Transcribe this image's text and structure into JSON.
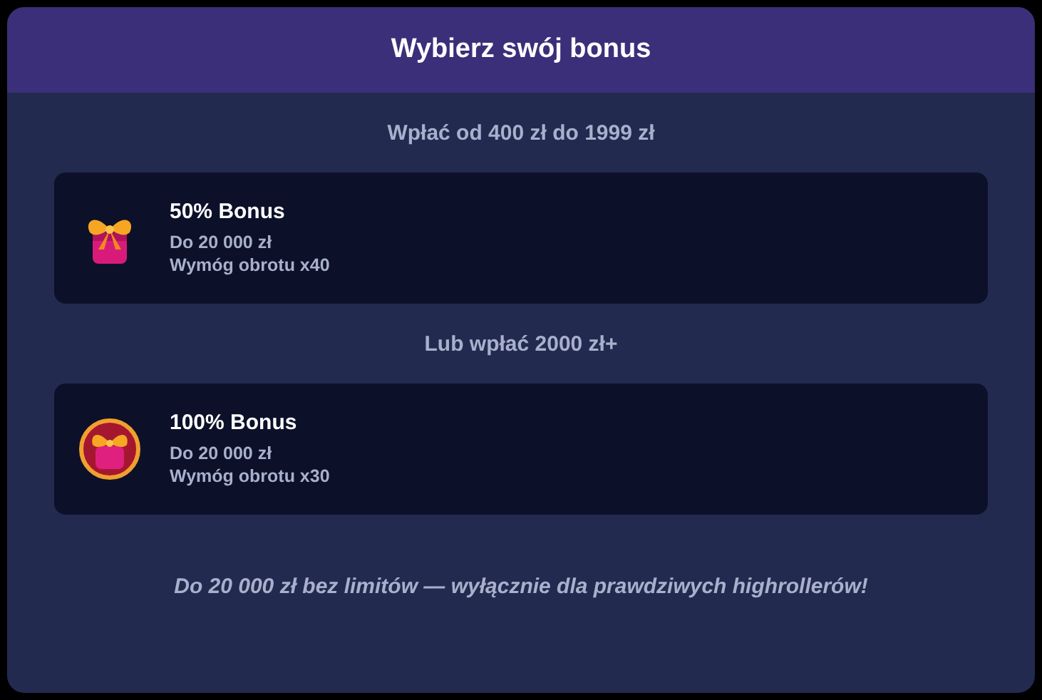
{
  "title": "Wybierz swój bonus",
  "sections": [
    {
      "heading": "Wpłać od 400 zł do 1999 zł",
      "offer": {
        "kind": "gift",
        "name": "50% Bonus",
        "lines": [
          "Do 20 000 zł",
          "Wymóg obrotu x40"
        ]
      }
    },
    {
      "heading": "Lub wpłać 2000 zł+",
      "offer": {
        "kind": "gift-medal",
        "name": "100% Bonus",
        "lines": [
          "Do 20 000 zł",
          "Wymóg obrotu x30"
        ]
      }
    }
  ],
  "footer": "Do 20 000 zł bez limitów — wyłącznie dla prawdziwych highrollerów!"
}
